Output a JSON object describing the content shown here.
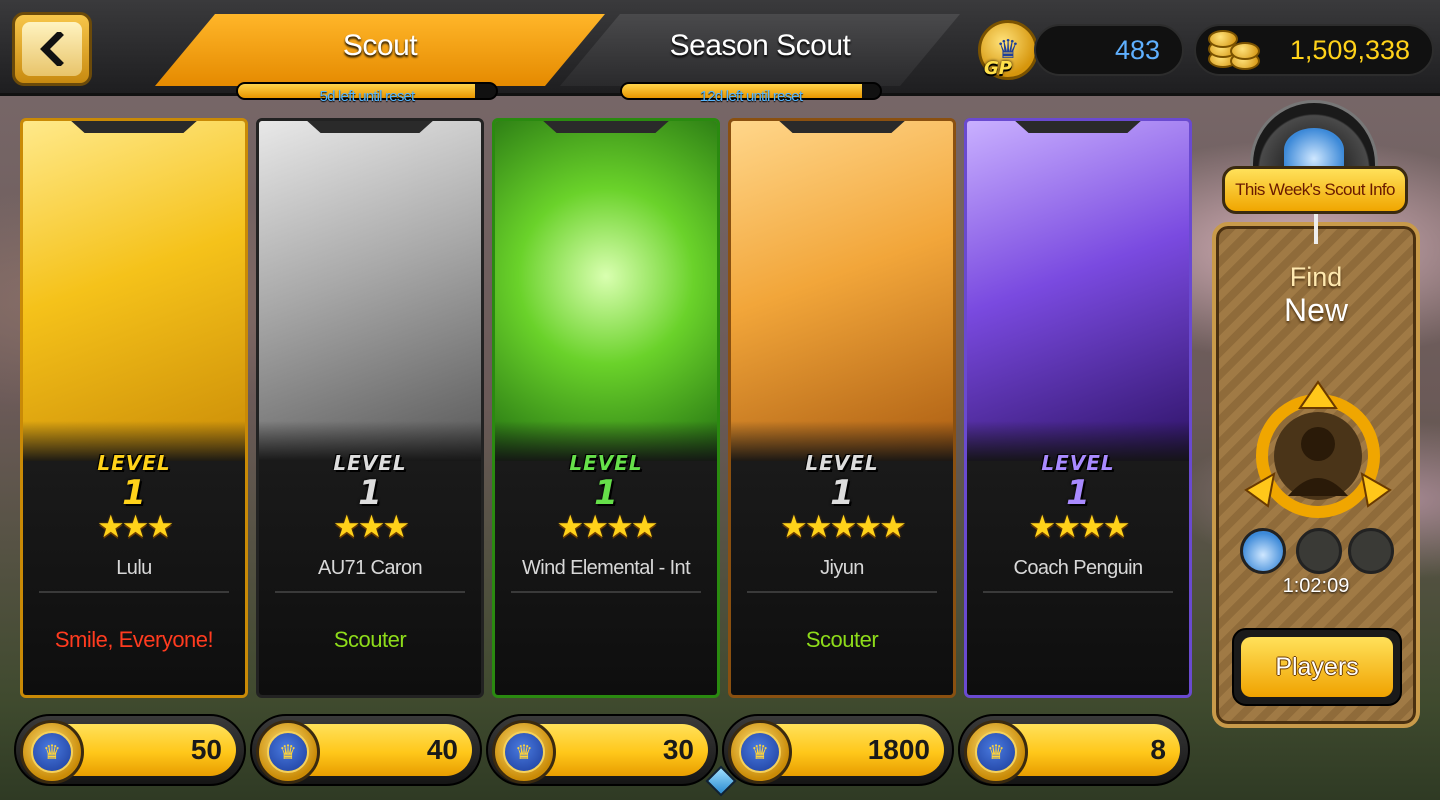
{
  "header": {
    "tabs": [
      {
        "label": "Scout",
        "active": true,
        "timer": "5d left until reset",
        "timer_progress": 0.92
      },
      {
        "label": "Season Scout",
        "active": false,
        "timer": "12d left until reset",
        "timer_progress": 0.93
      }
    ],
    "gp_label": "GP",
    "gp_value": "483",
    "gold_value": "1,509,338"
  },
  "cards": [
    {
      "name": "Lulu",
      "level_word": "LEVEL",
      "level": "1",
      "stars": 3,
      "stars_text": "★★★",
      "trait": "Smile, Everyone!",
      "trait_color": "#ff3b1f",
      "art_theme": "yellow",
      "price": "50",
      "level_color": "#ffd21a"
    },
    {
      "name": "AU71 Caron",
      "level_word": "LEVEL",
      "level": "1",
      "stars": 3,
      "stars_text": "★★★",
      "trait": "Scouter",
      "trait_color": "#8edc1a",
      "art_theme": "grey",
      "price": "40",
      "level_color": "#dddddd"
    },
    {
      "name": "Wind Elemental - Int",
      "level_word": "LEVEL",
      "level": "1",
      "stars": 4,
      "stars_text": "★★★★",
      "trait": "",
      "trait_color": "#8edc1a",
      "art_theme": "green",
      "price": "30",
      "level_color": "#66e04a"
    },
    {
      "name": "Jiyun",
      "level_word": "LEVEL",
      "level": "1",
      "stars": 5,
      "stars_text": "★★★★★",
      "trait": "Scouter",
      "trait_color": "#8edc1a",
      "art_theme": "orange",
      "price": "1800",
      "level_color": "#dddddd"
    },
    {
      "name": "Coach Penguin",
      "level_word": "LEVEL",
      "level": "1",
      "stars": 4,
      "stars_text": "★★★★",
      "trait": "",
      "trait_color": "#8edc1a",
      "art_theme": "purple",
      "price": "8",
      "level_color": "#a98aff"
    }
  ],
  "sidebar": {
    "info_button": "This Week's Scout Info",
    "find_line1": "Find",
    "find_line2": "New",
    "countdown": "1:02:09",
    "players_button": "Players"
  },
  "colors": {
    "accent": "#ffc71a",
    "gp_value": "#5fb0ff",
    "gold_value": "#ffd21a"
  }
}
